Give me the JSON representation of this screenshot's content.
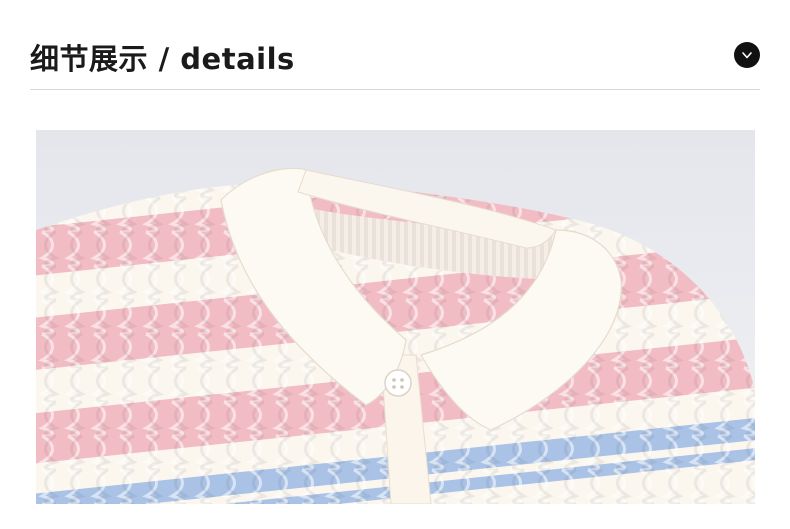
{
  "header": {
    "title": "细节展示 / details",
    "toggle_icon": "chevron-down-icon"
  },
  "photo": {
    "subject": "sweater-collar-detail-photo"
  },
  "colors": {
    "title": "#1a1a1a",
    "toggle_bg": "#111111",
    "divider": "#d8d8d8",
    "knit_pink": "#f2bcc4",
    "knit_cream": "#fbf7ef",
    "knit_blue": "#a9c2e6",
    "backdrop": "#eceef2"
  }
}
